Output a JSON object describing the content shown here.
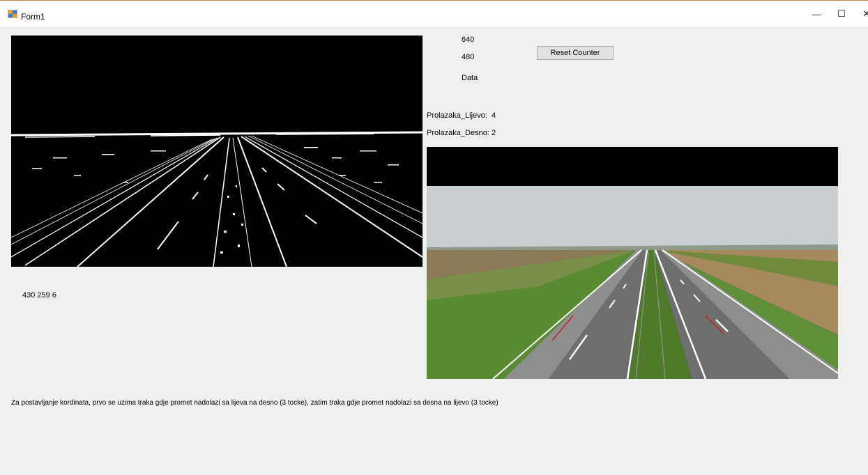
{
  "window": {
    "title": "Form1",
    "controls": {
      "minimize": "—",
      "maximize": "☐",
      "close": "✕"
    }
  },
  "labels": {
    "width": "640",
    "height": "480",
    "data": "Data",
    "left_count_label": "Prolazaka_Lijevo:",
    "left_count_value": "4",
    "right_count_label": "Prolazaka_Desno:",
    "right_count_value": "2",
    "coords": "430 259 6",
    "instructions": "Za postavljanje kordinata, prvo se uzima traka gdje promet nadolazi sa lijeva na desno (3 tocke), zatim traka gdje promet nadolazi sa desna na lijevo (3 tocke)"
  },
  "buttons": {
    "reset_counter": "Reset Counter"
  },
  "colors": {
    "window_bg": "#f0f0f0",
    "sky": "#c9ced1",
    "field_green": "#5a8a32",
    "road": "#6d6f6c",
    "lane_marker": "#d42020"
  },
  "icons": {
    "app": "form-app-icon"
  }
}
